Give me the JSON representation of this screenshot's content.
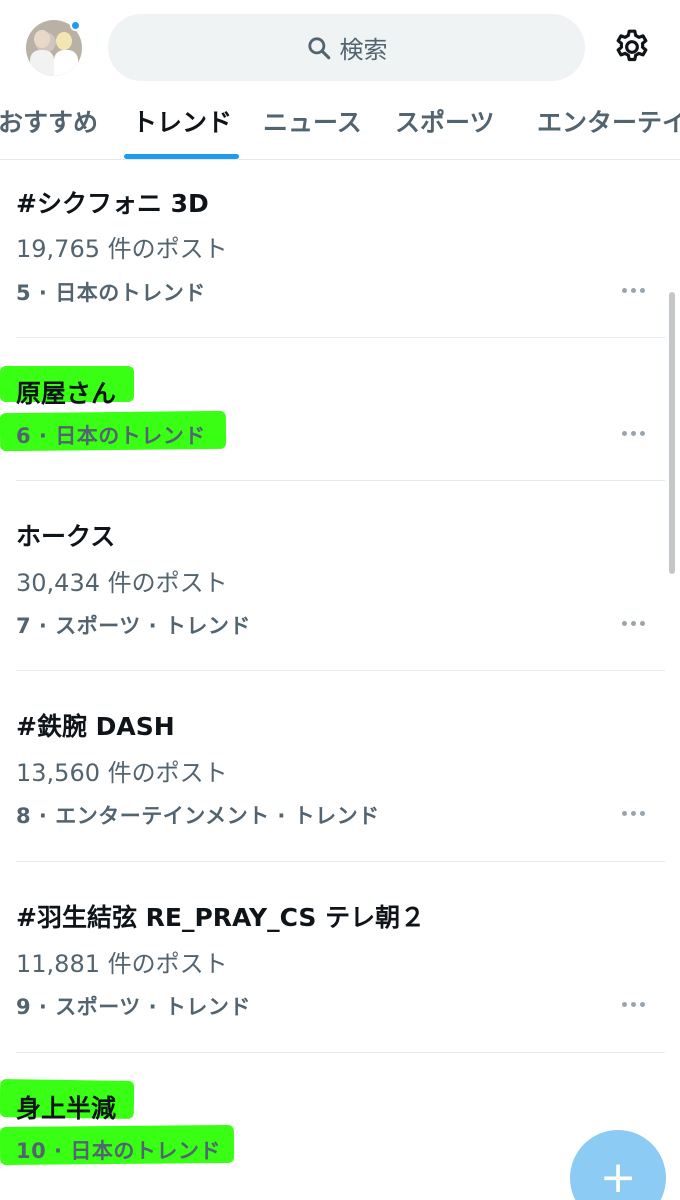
{
  "header": {
    "search_placeholder": "検索",
    "icons": {
      "search": "search-icon",
      "settings": "gear-icon",
      "avatar": "avatar",
      "compose": "plus-icon"
    }
  },
  "tabs": [
    {
      "label": "おすすめ",
      "active": false
    },
    {
      "label": "トレンド",
      "active": true
    },
    {
      "label": "ニュース",
      "active": false
    },
    {
      "label": "スポーツ",
      "active": false
    },
    {
      "label": "エンターテイ",
      "active": false
    }
  ],
  "trends": [
    {
      "title": "#シクフォニ 3D",
      "count": "19,765 件のポスト",
      "meta": "5 · 日本のトレンド"
    },
    {
      "title": "原屋さん",
      "count": "",
      "meta": "6 · 日本のトレンド"
    },
    {
      "title": "ホークス",
      "count": "30,434 件のポスト",
      "meta": "7 · スポーツ · トレンド"
    },
    {
      "title": "#鉄腕 DASH",
      "count": "13,560 件のポスト",
      "meta": "8 · エンターテインメント · トレンド"
    },
    {
      "title": "#羽生結弦 RE_PRAY_CS テレ朝２",
      "count": "11,881 件のポスト",
      "meta": "9 · スポーツ · トレンド"
    },
    {
      "title": "身上半減",
      "count": "",
      "meta": "10 · 日本のトレンド"
    }
  ],
  "colors": {
    "accent": "#1d9bf0",
    "highlight": "#39ff14",
    "secondary_text": "#536471"
  },
  "fab": {
    "label": "+"
  }
}
